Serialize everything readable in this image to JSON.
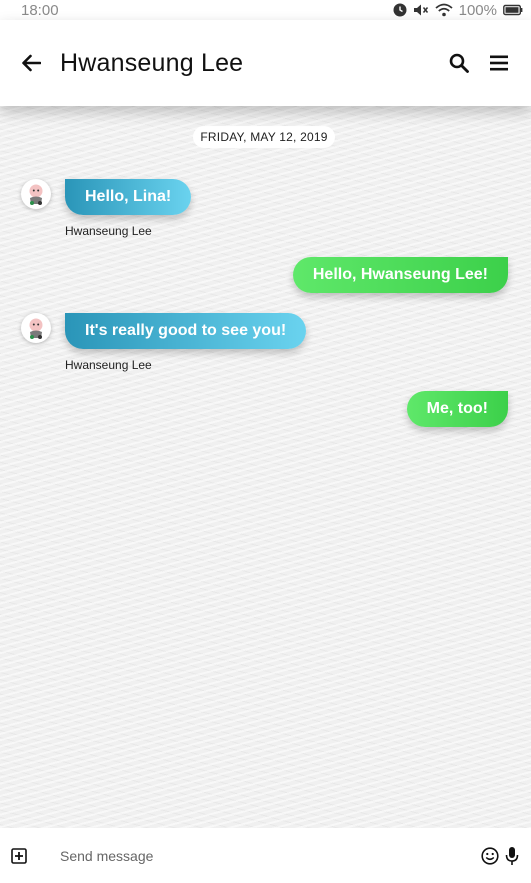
{
  "status_bar": {
    "time": "18:00",
    "battery": "100%",
    "icons": [
      "alarm-icon",
      "mute-icon",
      "wifi-icon",
      "battery-icon"
    ]
  },
  "header": {
    "title": "Hwanseung Lee",
    "icons": [
      "back-arrow-icon",
      "search-icon",
      "menu-icon"
    ]
  },
  "conversation": {
    "date": "FRIDAY, MAY 12, 2019",
    "messages": [
      {
        "direction": "incoming",
        "text": "Hello, Lina!",
        "sender": "Hwanseung Lee"
      },
      {
        "direction": "outgoing",
        "text": "Hello, Hwanseung Lee!"
      },
      {
        "direction": "incoming",
        "text": "It's really good to see you!",
        "sender": "Hwanseung Lee"
      },
      {
        "direction": "outgoing",
        "text": "Me, too!"
      }
    ]
  },
  "composer": {
    "placeholder": "Send message",
    "value": "",
    "icons": [
      "plus-box-icon",
      "emoji-icon",
      "microphone-icon"
    ]
  },
  "colors": {
    "incoming_start": "#2a95b8",
    "incoming_end": "#6ad3ef",
    "outgoing": "#4fdc5a",
    "background": "#f0f0f0"
  }
}
